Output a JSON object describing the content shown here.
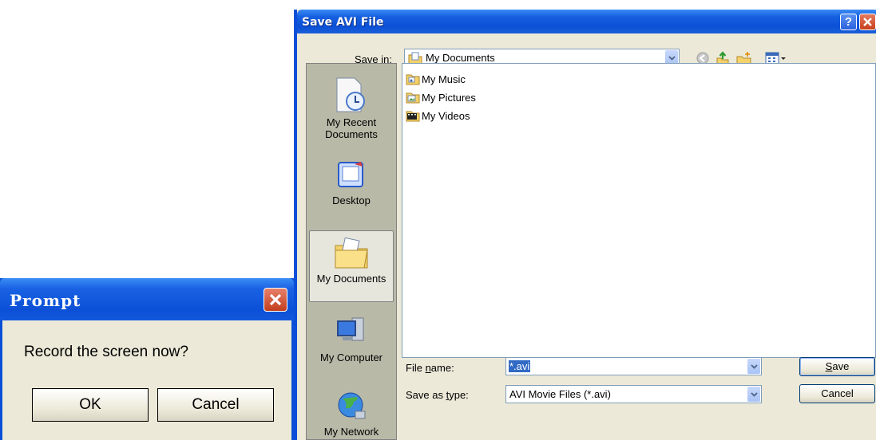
{
  "save_dialog": {
    "title": "Save AVI File",
    "help_glyph": "?",
    "save_in_label": "Save in:",
    "save_in_value": "My Documents",
    "toolbar_icons": [
      "back-icon",
      "up-folder-icon",
      "new-folder-icon",
      "view-menu-icon"
    ],
    "places": [
      {
        "label": "My Recent Documents",
        "icon": "recent-documents-icon"
      },
      {
        "label": "Desktop",
        "icon": "desktop-icon"
      },
      {
        "label": "My Documents",
        "icon": "my-documents-icon"
      },
      {
        "label": "My Computer",
        "icon": "my-computer-icon"
      },
      {
        "label": "My Network",
        "icon": "my-network-icon"
      }
    ],
    "files": [
      {
        "name": "My Music",
        "icon": "music-folder-icon"
      },
      {
        "name": "My Pictures",
        "icon": "pictures-folder-icon"
      },
      {
        "name": "My Videos",
        "icon": "videos-folder-icon"
      }
    ],
    "file_name_label": "File name:",
    "file_name_value": "*.avi",
    "save_type_label": "Save as type:",
    "save_type_value": "AVI Movie Files (*.avi)",
    "save_button": "Save",
    "cancel_button": "Cancel"
  },
  "prompt": {
    "title": "Prompt",
    "message": "Record the screen now?",
    "ok_button": "OK",
    "cancel_button": "Cancel"
  },
  "colors": {
    "titlebar": "#0b50d6",
    "dialog_bg": "#ece9d8",
    "close_red": "#c6401c",
    "selection": "#316ac5"
  }
}
